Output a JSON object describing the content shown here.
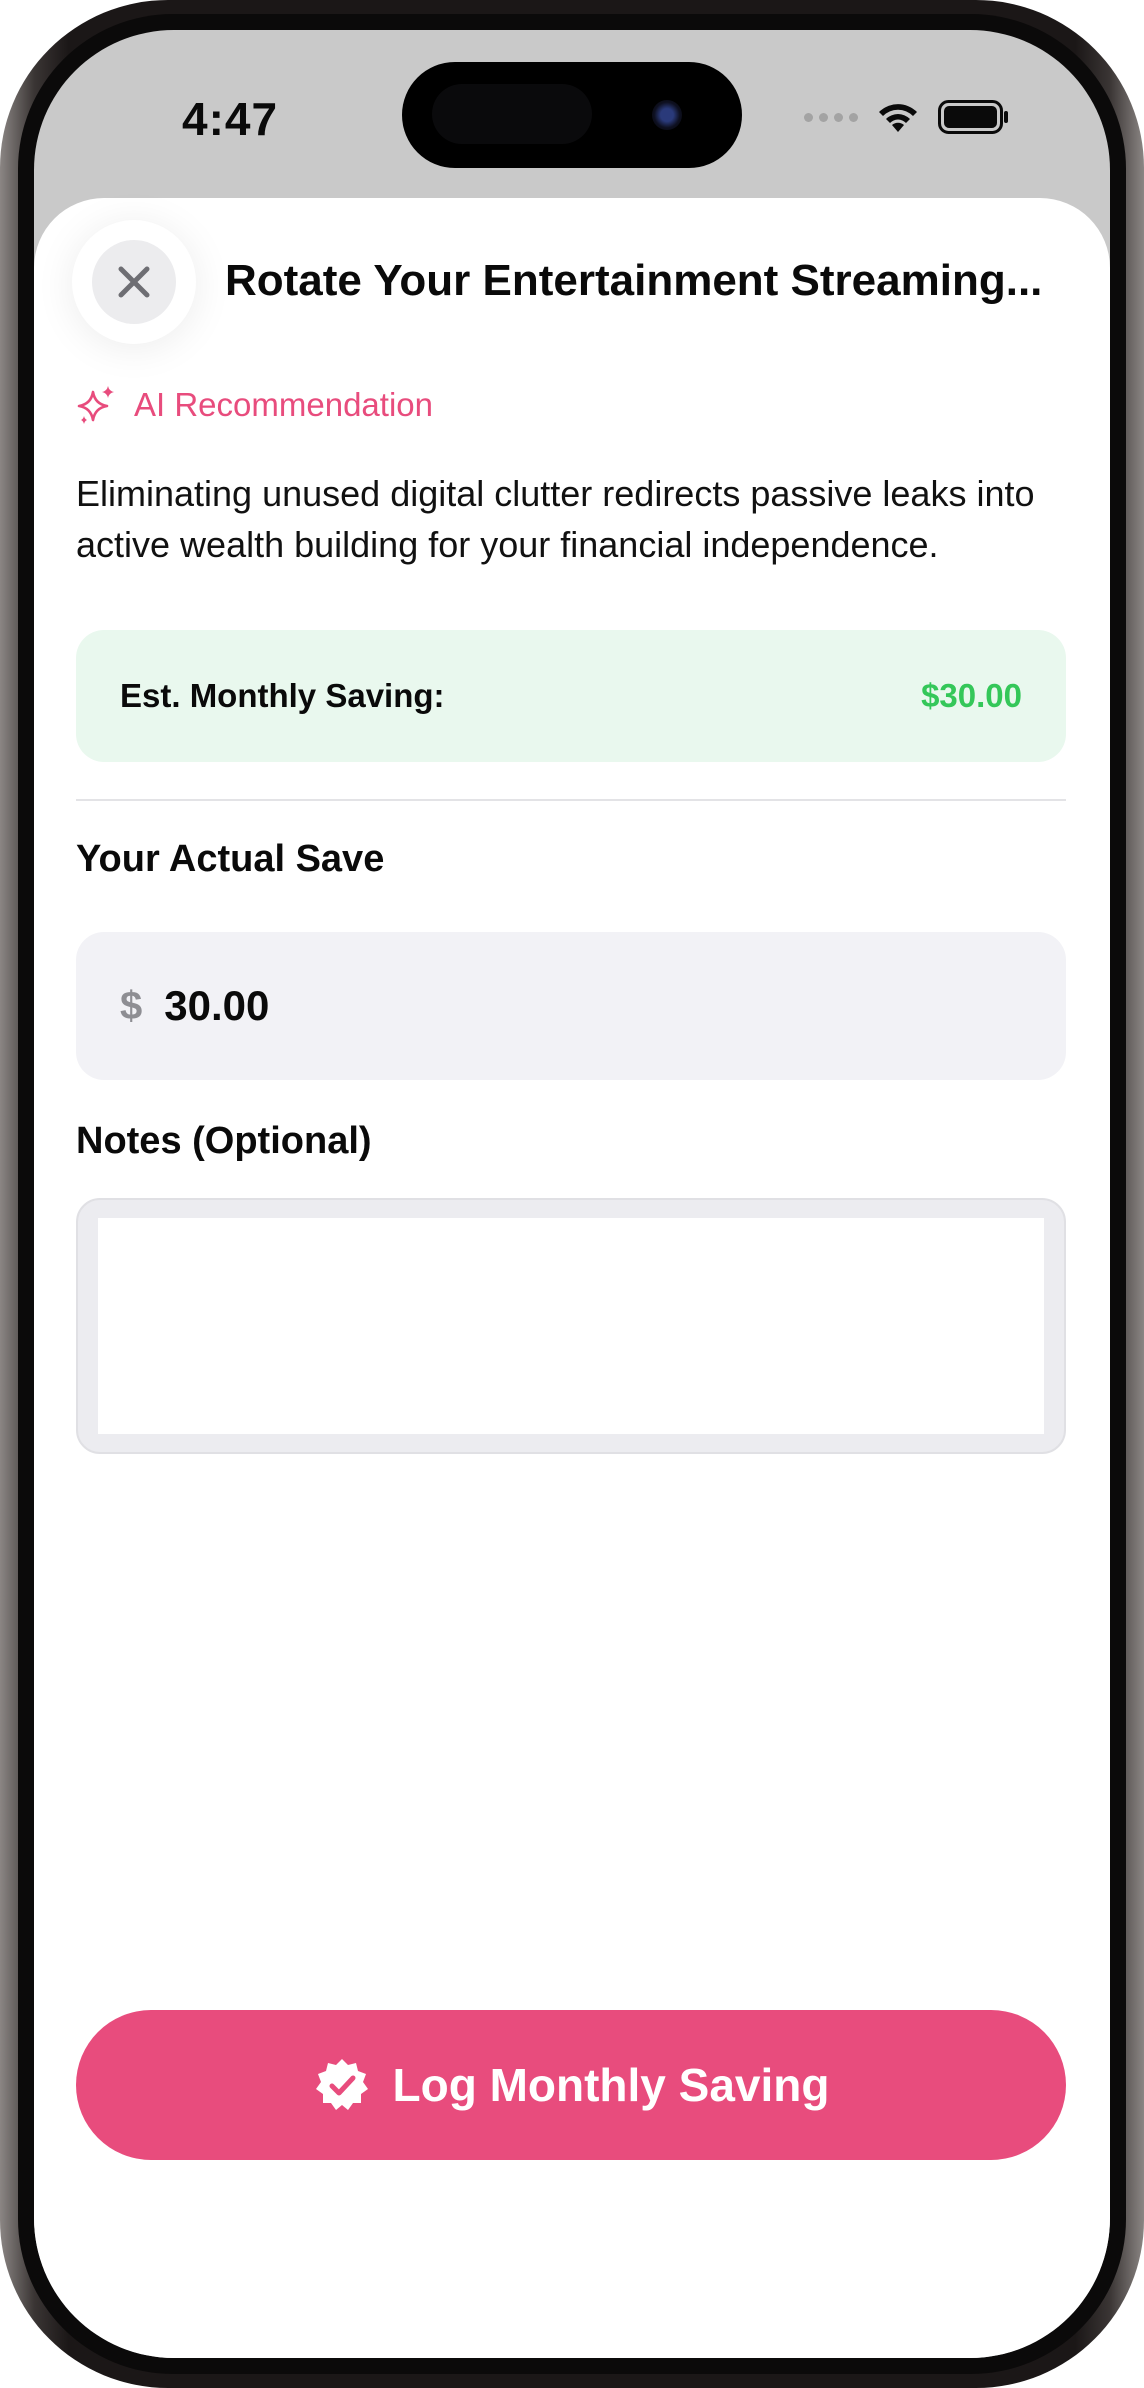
{
  "status_bar": {
    "time": "4:47"
  },
  "sheet": {
    "title": "Rotate Your Entertainment Streaming...",
    "ai_label": "AI Recommendation",
    "description": "Eliminating unused digital clutter redirects passive leaks into active wealth building for your financial independence.",
    "estimate": {
      "label": "Est. Monthly Saving:",
      "value": "$30.00"
    },
    "actual_save": {
      "label": "Your Actual Save",
      "currency": "$",
      "value": "30.00"
    },
    "notes": {
      "label": "Notes (Optional)",
      "value": ""
    },
    "cta_label": "Log Monthly Saving"
  },
  "icons": {
    "close": "close-icon",
    "ai": "sparkles-icon",
    "cta": "checkmark-seal-icon",
    "wifi": "wifi-icon",
    "battery": "battery-icon"
  },
  "colors": {
    "accent": "#e84c7d",
    "positive": "#34c759",
    "card_green": "#e9f8ee",
    "field_bg": "#f2f2f6"
  }
}
